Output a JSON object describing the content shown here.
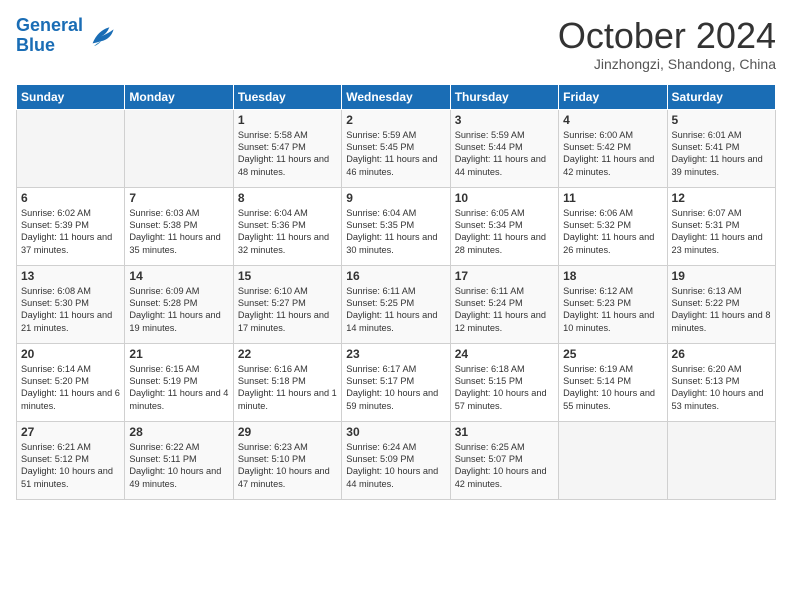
{
  "header": {
    "logo_line1": "General",
    "logo_line2": "Blue",
    "month": "October 2024",
    "location": "Jinzhongzi, Shandong, China"
  },
  "weekdays": [
    "Sunday",
    "Monday",
    "Tuesday",
    "Wednesday",
    "Thursday",
    "Friday",
    "Saturday"
  ],
  "weeks": [
    [
      {
        "day": "",
        "info": ""
      },
      {
        "day": "",
        "info": ""
      },
      {
        "day": "1",
        "info": "Sunrise: 5:58 AM\nSunset: 5:47 PM\nDaylight: 11 hours and 48 minutes."
      },
      {
        "day": "2",
        "info": "Sunrise: 5:59 AM\nSunset: 5:45 PM\nDaylight: 11 hours and 46 minutes."
      },
      {
        "day": "3",
        "info": "Sunrise: 5:59 AM\nSunset: 5:44 PM\nDaylight: 11 hours and 44 minutes."
      },
      {
        "day": "4",
        "info": "Sunrise: 6:00 AM\nSunset: 5:42 PM\nDaylight: 11 hours and 42 minutes."
      },
      {
        "day": "5",
        "info": "Sunrise: 6:01 AM\nSunset: 5:41 PM\nDaylight: 11 hours and 39 minutes."
      }
    ],
    [
      {
        "day": "6",
        "info": "Sunrise: 6:02 AM\nSunset: 5:39 PM\nDaylight: 11 hours and 37 minutes."
      },
      {
        "day": "7",
        "info": "Sunrise: 6:03 AM\nSunset: 5:38 PM\nDaylight: 11 hours and 35 minutes."
      },
      {
        "day": "8",
        "info": "Sunrise: 6:04 AM\nSunset: 5:36 PM\nDaylight: 11 hours and 32 minutes."
      },
      {
        "day": "9",
        "info": "Sunrise: 6:04 AM\nSunset: 5:35 PM\nDaylight: 11 hours and 30 minutes."
      },
      {
        "day": "10",
        "info": "Sunrise: 6:05 AM\nSunset: 5:34 PM\nDaylight: 11 hours and 28 minutes."
      },
      {
        "day": "11",
        "info": "Sunrise: 6:06 AM\nSunset: 5:32 PM\nDaylight: 11 hours and 26 minutes."
      },
      {
        "day": "12",
        "info": "Sunrise: 6:07 AM\nSunset: 5:31 PM\nDaylight: 11 hours and 23 minutes."
      }
    ],
    [
      {
        "day": "13",
        "info": "Sunrise: 6:08 AM\nSunset: 5:30 PM\nDaylight: 11 hours and 21 minutes."
      },
      {
        "day": "14",
        "info": "Sunrise: 6:09 AM\nSunset: 5:28 PM\nDaylight: 11 hours and 19 minutes."
      },
      {
        "day": "15",
        "info": "Sunrise: 6:10 AM\nSunset: 5:27 PM\nDaylight: 11 hours and 17 minutes."
      },
      {
        "day": "16",
        "info": "Sunrise: 6:11 AM\nSunset: 5:25 PM\nDaylight: 11 hours and 14 minutes."
      },
      {
        "day": "17",
        "info": "Sunrise: 6:11 AM\nSunset: 5:24 PM\nDaylight: 11 hours and 12 minutes."
      },
      {
        "day": "18",
        "info": "Sunrise: 6:12 AM\nSunset: 5:23 PM\nDaylight: 11 hours and 10 minutes."
      },
      {
        "day": "19",
        "info": "Sunrise: 6:13 AM\nSunset: 5:22 PM\nDaylight: 11 hours and 8 minutes."
      }
    ],
    [
      {
        "day": "20",
        "info": "Sunrise: 6:14 AM\nSunset: 5:20 PM\nDaylight: 11 hours and 6 minutes."
      },
      {
        "day": "21",
        "info": "Sunrise: 6:15 AM\nSunset: 5:19 PM\nDaylight: 11 hours and 4 minutes."
      },
      {
        "day": "22",
        "info": "Sunrise: 6:16 AM\nSunset: 5:18 PM\nDaylight: 11 hours and 1 minute."
      },
      {
        "day": "23",
        "info": "Sunrise: 6:17 AM\nSunset: 5:17 PM\nDaylight: 10 hours and 59 minutes."
      },
      {
        "day": "24",
        "info": "Sunrise: 6:18 AM\nSunset: 5:15 PM\nDaylight: 10 hours and 57 minutes."
      },
      {
        "day": "25",
        "info": "Sunrise: 6:19 AM\nSunset: 5:14 PM\nDaylight: 10 hours and 55 minutes."
      },
      {
        "day": "26",
        "info": "Sunrise: 6:20 AM\nSunset: 5:13 PM\nDaylight: 10 hours and 53 minutes."
      }
    ],
    [
      {
        "day": "27",
        "info": "Sunrise: 6:21 AM\nSunset: 5:12 PM\nDaylight: 10 hours and 51 minutes."
      },
      {
        "day": "28",
        "info": "Sunrise: 6:22 AM\nSunset: 5:11 PM\nDaylight: 10 hours and 49 minutes."
      },
      {
        "day": "29",
        "info": "Sunrise: 6:23 AM\nSunset: 5:10 PM\nDaylight: 10 hours and 47 minutes."
      },
      {
        "day": "30",
        "info": "Sunrise: 6:24 AM\nSunset: 5:09 PM\nDaylight: 10 hours and 44 minutes."
      },
      {
        "day": "31",
        "info": "Sunrise: 6:25 AM\nSunset: 5:07 PM\nDaylight: 10 hours and 42 minutes."
      },
      {
        "day": "",
        "info": ""
      },
      {
        "day": "",
        "info": ""
      }
    ]
  ]
}
